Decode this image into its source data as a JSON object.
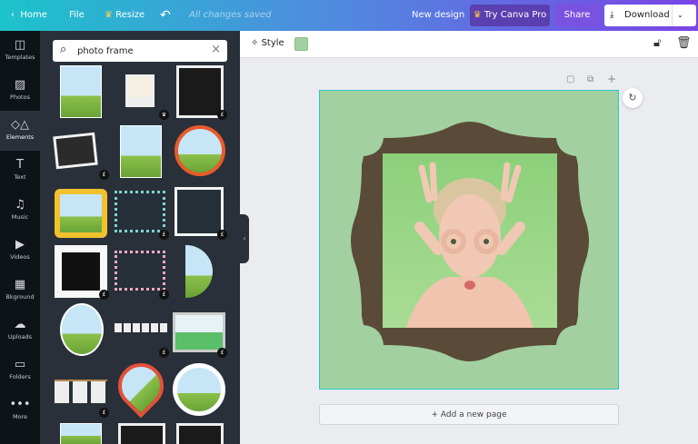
{
  "topbar": {
    "home": "Home",
    "file": "File",
    "resize": "Resize",
    "status": "All changes saved",
    "new_design": "New design",
    "try_pro": "Try Canva Pro",
    "share": "Share",
    "download": "Download"
  },
  "sidebar": {
    "items": [
      {
        "label": "Templates",
        "icon": "templates-icon"
      },
      {
        "label": "Photos",
        "icon": "photos-icon"
      },
      {
        "label": "Elements",
        "icon": "elements-icon"
      },
      {
        "label": "Text",
        "icon": "text-icon"
      },
      {
        "label": "Music",
        "icon": "music-icon"
      },
      {
        "label": "Videos",
        "icon": "videos-icon"
      },
      {
        "label": "Bkground",
        "icon": "background-icon"
      },
      {
        "label": "Uploads",
        "icon": "uploads-icon"
      },
      {
        "label": "Folders",
        "icon": "folders-icon"
      },
      {
        "label": "More",
        "icon": "more-icon"
      }
    ],
    "active": "Elements"
  },
  "search": {
    "value": "photo frame"
  },
  "elements": [
    {
      "kind": "rect-photo",
      "badge": ""
    },
    {
      "kind": "polaroid",
      "badge": "crown"
    },
    {
      "kind": "black-frame",
      "badge": "£"
    },
    {
      "kind": "polaroid-stack",
      "badge": "£"
    },
    {
      "kind": "rect-photo",
      "badge": ""
    },
    {
      "kind": "orange-circle",
      "badge": ""
    },
    {
      "kind": "gold-frame",
      "badge": ""
    },
    {
      "kind": "dotted-teal",
      "badge": "£"
    },
    {
      "kind": "white-square",
      "badge": "£"
    },
    {
      "kind": "white-perspective",
      "badge": "£"
    },
    {
      "kind": "dotted-pink",
      "badge": "£"
    },
    {
      "kind": "half-circle",
      "badge": ""
    },
    {
      "kind": "oval-photo",
      "badge": ""
    },
    {
      "kind": "film-strip",
      "badge": "£"
    },
    {
      "kind": "hanging-frame",
      "badge": "£"
    },
    {
      "kind": "clothesline",
      "badge": "£"
    },
    {
      "kind": "pin-photo",
      "badge": ""
    },
    {
      "kind": "circle-photo",
      "badge": ""
    },
    {
      "kind": "rect-photo",
      "badge": ""
    },
    {
      "kind": "black-frame",
      "badge": ""
    },
    {
      "kind": "black-frame",
      "badge": ""
    }
  ],
  "toolbar": {
    "style": "Style",
    "color": "#a3d0a0"
  },
  "canvas": {
    "background": "#a3d0a0",
    "frame_color": "#5a4a38",
    "add_page": "+ Add a new page"
  },
  "colors": {
    "accent": "#7a44e6",
    "sidebar": "#0e1318",
    "panel": "#293039"
  }
}
